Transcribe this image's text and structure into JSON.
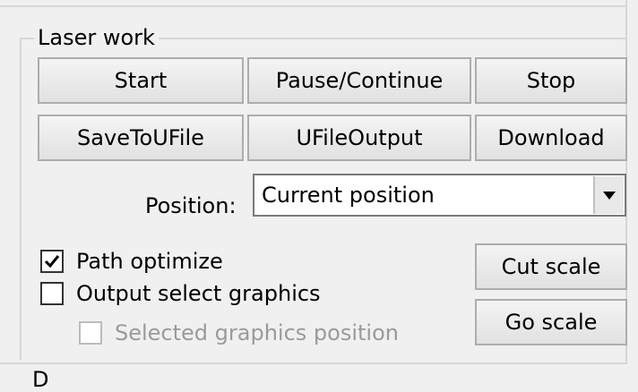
{
  "group": {
    "title": "Laser work"
  },
  "buttons": {
    "start": "Start",
    "pause_continue": "Pause/Continue",
    "stop": "Stop",
    "save_to_ufile": "SaveToUFile",
    "ufile_output": "UFileOutput",
    "download": "Download",
    "cut_scale": "Cut scale",
    "go_scale": "Go scale"
  },
  "position": {
    "label": "Position:",
    "selected": "Current position"
  },
  "options": {
    "path_optimize": {
      "label": "Path optimize",
      "checked": true,
      "enabled": true
    },
    "output_select_graphics": {
      "label": "Output select graphics",
      "checked": false,
      "enabled": true
    },
    "selected_graphics_position": {
      "label": "Selected graphics position",
      "checked": false,
      "enabled": false
    }
  },
  "next_section": {
    "title_partial": "D"
  }
}
